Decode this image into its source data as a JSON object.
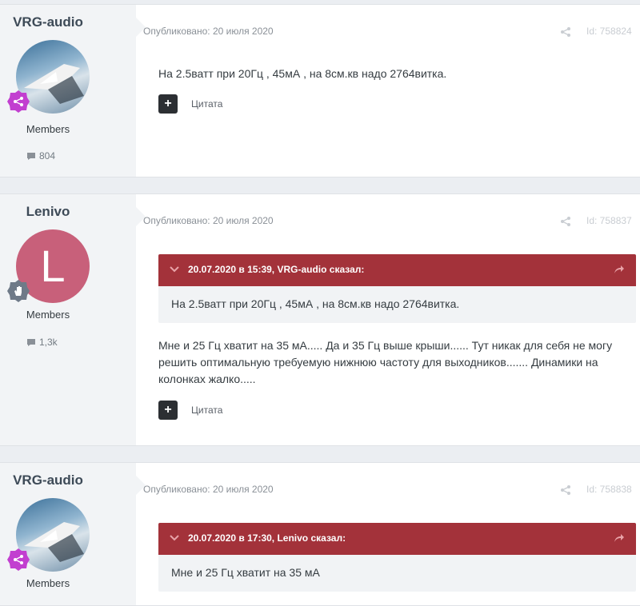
{
  "posts": [
    {
      "author": "VRG-audio",
      "avatar_type": "photo",
      "badge_icon": "share-nodes-icon",
      "badge_color": "#c23fd0",
      "group": "Members",
      "count_icon": "comment-icon",
      "count": "804",
      "published": "Опубликовано: 20 июля 2020",
      "id": "Id: 758824",
      "text": "На 2.5ватт при 20Гц  , 45мА , на 8см.кв надо 2764витка.",
      "quote_label": "Цитата"
    },
    {
      "author": "Lenivo",
      "avatar_type": "letter",
      "avatar_letter": "L",
      "badge_icon": "hand-wave-icon",
      "badge_color": "#6f7a88",
      "group": "Members",
      "count_icon": "comment-icon",
      "count": "1,3k",
      "published": "Опубликовано: 20 июля 2020",
      "id": "Id: 758837",
      "quote": {
        "title": "20.07.2020 в 15:39, VRG-audio сказал:",
        "text": "На 2.5ватт при 20Гц  , 45мА , на 8см.кв надо 2764витка."
      },
      "text_lines": [
        "Мне и 25 Гц хватит на 35 мА..... Да и 35 Гц выше крыши...... Тут никак для себя не могу",
        "решить  оптимальную требуемую нижнюю частоту для выходников....... Динамики на",
        "колонках жалко....."
      ],
      "quote_label": "Цитата"
    },
    {
      "author": "VRG-audio",
      "avatar_type": "photo",
      "badge_icon": "share-nodes-icon",
      "badge_color": "#c23fd0",
      "group": "Members",
      "published": "Опубликовано: 20 июля 2020",
      "id": "Id: 758838",
      "quote": {
        "title": "20.07.2020 в 17:30, Lenivo сказал:",
        "text": "Мне и 25 Гц хватит на 35 мА"
      }
    }
  ]
}
